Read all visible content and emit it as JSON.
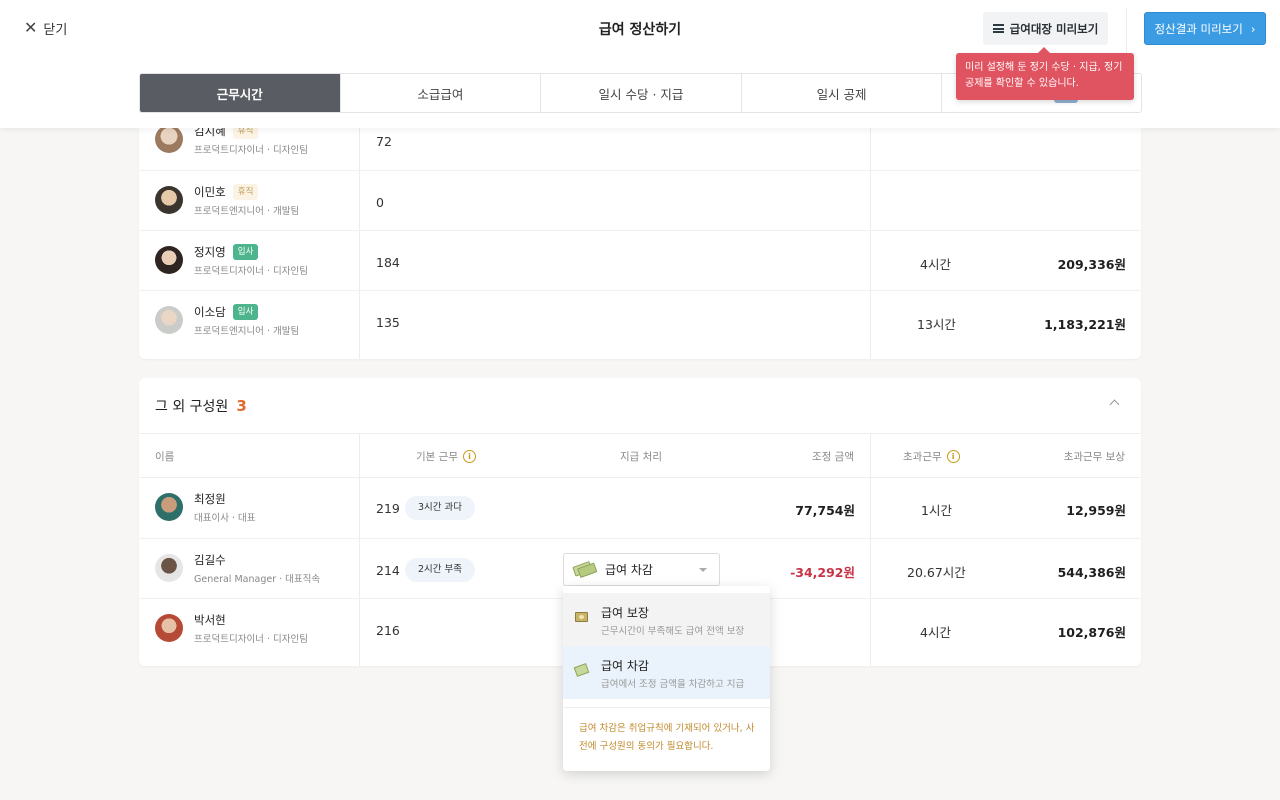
{
  "header": {
    "close_label": "닫기",
    "title": "급여 정산하기",
    "preview_payroll_label": "급여대장 미리보기",
    "preview_result_label": "정산결과 미리보기",
    "tooltip": "미리 설정해 둔 정기 수당 · 지급, 정기 공제를 확인할 수 있습니다."
  },
  "tabs": [
    {
      "label": "근무시간",
      "active": true
    },
    {
      "label": "소급급여",
      "active": false
    },
    {
      "label": "일시 수당 · 지급",
      "active": false
    },
    {
      "label": "일시 공제",
      "active": false
    },
    {
      "label": "",
      "active": false
    }
  ],
  "top_rows": [
    {
      "name": "김지혜",
      "badge": "휴직",
      "badge_type": "leave",
      "sub": "프로덕트디자이너 · 디자인팀",
      "base": "72",
      "overtime": "",
      "overtime_pay": ""
    },
    {
      "name": "이민호",
      "badge": "휴직",
      "badge_type": "leave",
      "sub": "프로덕트엔지니어 · 개발팀",
      "base": "0",
      "overtime": "",
      "overtime_pay": ""
    },
    {
      "name": "정지영",
      "badge": "입사",
      "badge_type": "join",
      "sub": "프로덕트디자이너 · 디자인팀",
      "base": "184",
      "overtime": "4시간",
      "overtime_pay": "209,336원"
    },
    {
      "name": "이소담",
      "badge": "입사",
      "badge_type": "join",
      "sub": "프로덕트엔지니어 · 개발팀",
      "base": "135",
      "overtime": "13시간",
      "overtime_pay": "1,183,221원"
    }
  ],
  "others": {
    "title": "그 외 구성원",
    "count": "3",
    "columns": {
      "name": "이름",
      "base": "기본 근무",
      "payment": "지급 처리",
      "adjust": "조정 금액",
      "overtime": "초과근무",
      "overtime_pay": "초과근무 보상"
    },
    "rows": [
      {
        "name": "최정원",
        "sub": "대표이사 · 대표",
        "base": "219",
        "pill": "3시간 과다",
        "payment": "",
        "adjust": "77,754원",
        "overtime": "1시간",
        "overtime_pay": "12,959원"
      },
      {
        "name": "김길수",
        "sub": "General Manager · 대표직속",
        "base": "214",
        "pill": "2시간 부족",
        "payment": "급여 차감",
        "adjust": "-34,292원",
        "overtime": "20.67시간",
        "overtime_pay": "544,386원"
      },
      {
        "name": "박서현",
        "sub": "프로덕트디자이너 · 디자인팀",
        "base": "216",
        "pill": "",
        "payment": "",
        "adjust": "",
        "overtime": "4시간",
        "overtime_pay": "102,876원"
      }
    ]
  },
  "dropdown": {
    "options": [
      {
        "title": "급여 보장",
        "desc": "근무시간이 부족해도 급여 전액 보장",
        "icon": "money-bag-icon"
      },
      {
        "title": "급여 차감",
        "desc": "급여에서 조정 금액을 차감하고 지급",
        "icon": "money-wings-icon"
      }
    ],
    "note": "급여 차감은 취업규칙에 기재되어 있거나, 사전에 구성원의 동의가 필요합니다."
  },
  "colors": {
    "accent": "#3b9be3",
    "tooltip": "#e05360",
    "count": "#e2692f",
    "negative": "#c83447",
    "join_badge": "#4db48e"
  }
}
